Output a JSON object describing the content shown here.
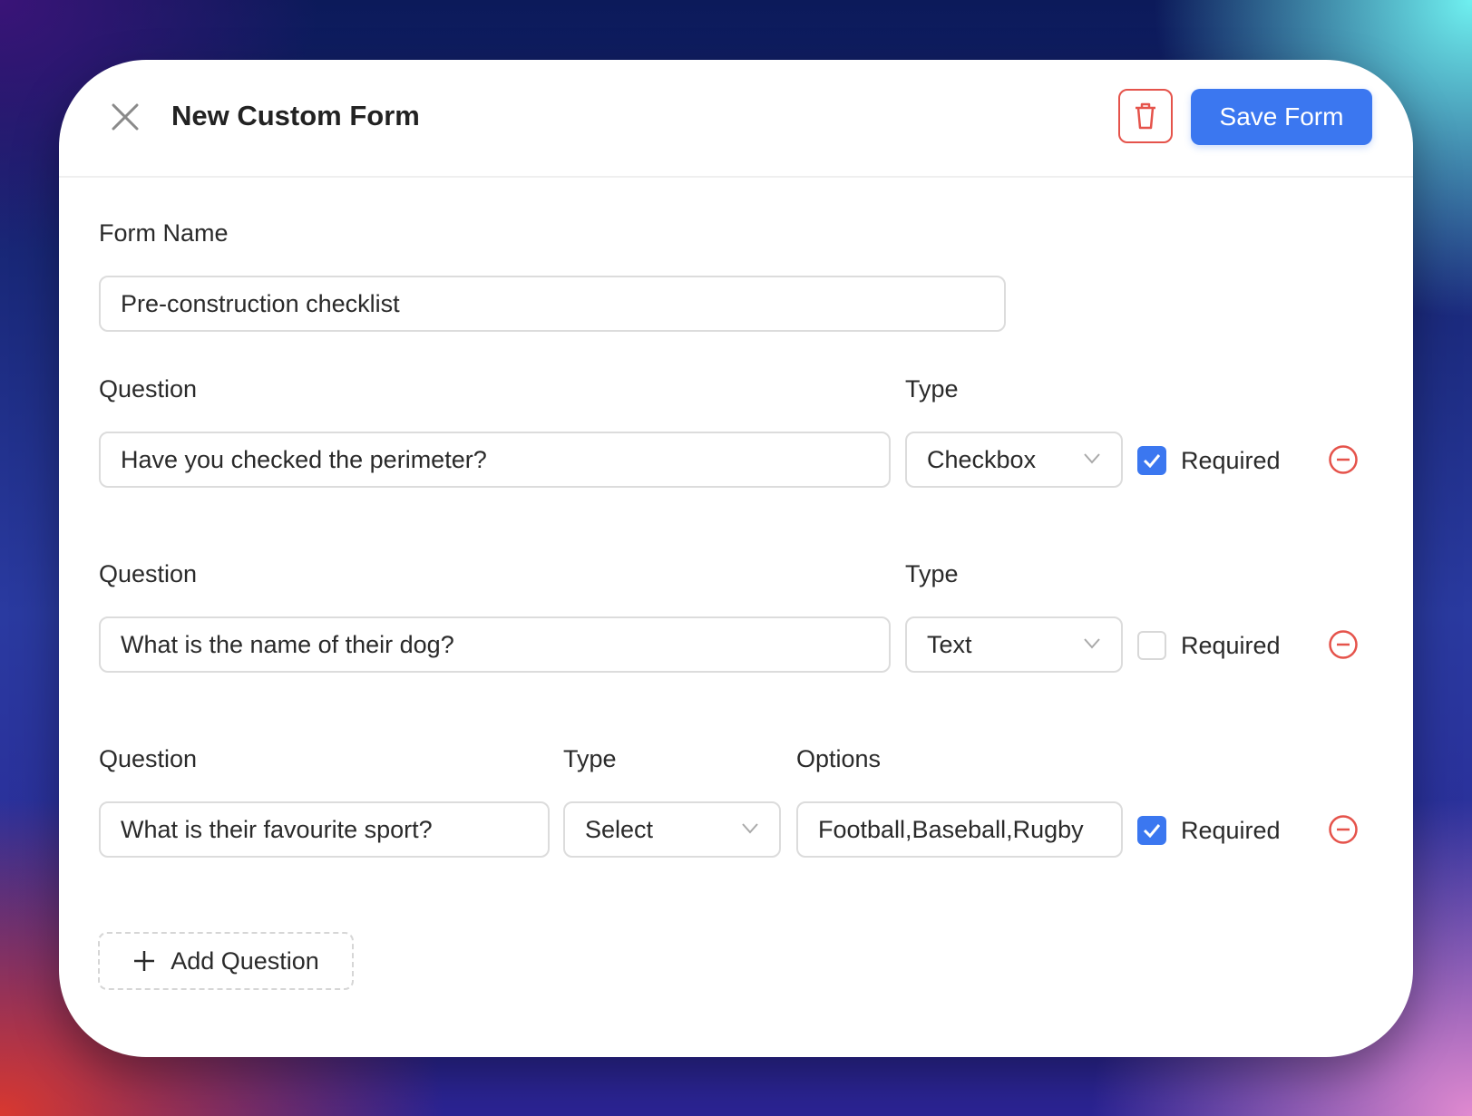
{
  "header": {
    "title": "New Custom Form",
    "save_label": "Save Form"
  },
  "form_name": {
    "label": "Form Name",
    "value": "Pre-construction checklist"
  },
  "questions": [
    {
      "question_label": "Question",
      "question": "Have you checked the perimeter?",
      "type_label": "Type",
      "type": "Checkbox",
      "required_label": "Required",
      "required": true
    },
    {
      "question_label": "Question",
      "question": "What is the name of their dog?",
      "type_label": "Type",
      "type": "Text",
      "required_label": "Required",
      "required": false
    },
    {
      "question_label": "Question",
      "question": "What is their favourite sport?",
      "type_label": "Type",
      "type": "Select",
      "options_label": "Options",
      "options": "Football,Baseball,Rugby",
      "required_label": "Required",
      "required": true
    }
  ],
  "add_question_label": "Add Question",
  "colors": {
    "accent": "#3b77f0",
    "danger": "#e5534b"
  }
}
